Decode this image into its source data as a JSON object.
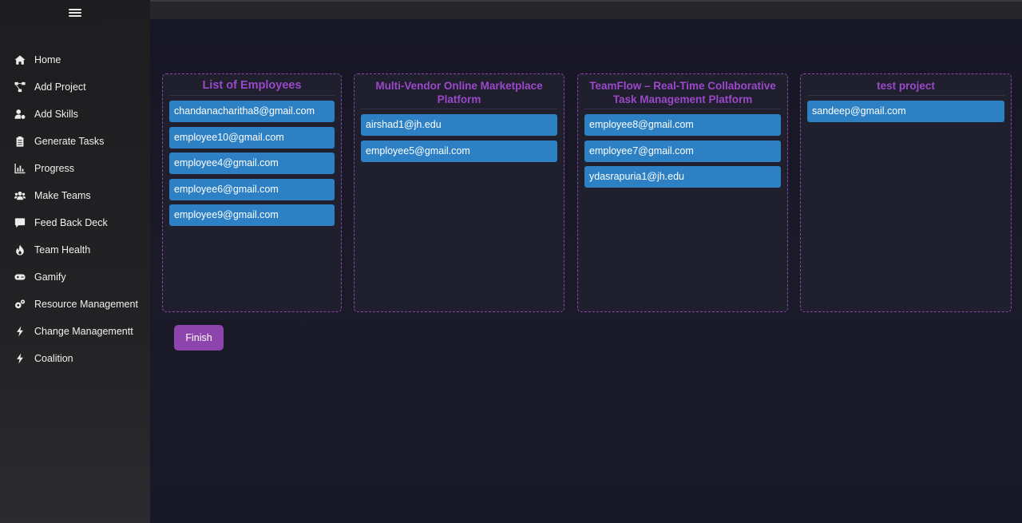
{
  "sidebar": {
    "menu_icon": "hamburger-icon",
    "items": [
      {
        "label": "Home",
        "icon": "home-icon"
      },
      {
        "label": "Add Project",
        "icon": "project-diagram-icon"
      },
      {
        "label": "Add Skills",
        "icon": "user-cog-icon"
      },
      {
        "label": "Generate Tasks",
        "icon": "clipboard-list-icon"
      },
      {
        "label": "Progress",
        "icon": "bar-chart-icon"
      },
      {
        "label": "Make Teams",
        "icon": "users-icon"
      },
      {
        "label": "Feed Back Deck",
        "icon": "comment-icon"
      },
      {
        "label": "Team Health",
        "icon": "fire-icon"
      },
      {
        "label": "Gamify",
        "icon": "gamepad-icon"
      },
      {
        "label": "Resource Management",
        "icon": "cogs-icon"
      },
      {
        "label": "Change Managementt",
        "icon": "bolt-icon"
      },
      {
        "label": "Coalition",
        "icon": "bolt-icon"
      }
    ]
  },
  "boards": [
    {
      "title": "List of Employees",
      "members": [
        "chandanacharitha8@gmail.com",
        "employee10@gmail.com",
        "employee4@gmail.com",
        "employee6@gmail.com",
        "employee9@gmail.com"
      ]
    },
    {
      "title": "Multi-Vendor Online Marketplace Platform",
      "members": [
        "airshad1@jh.edu",
        "employee5@gmail.com"
      ]
    },
    {
      "title": "TeamFlow – Real-Time Collaborative Task Management Platform",
      "members": [
        "employee8@gmail.com",
        "employee7@gmail.com",
        "ydasrapuria1@jh.edu"
      ]
    },
    {
      "title": "test project",
      "members": [
        "sandeep@gmail.com"
      ]
    }
  ],
  "actions": {
    "finish_label": "Finish"
  },
  "colors": {
    "accent": "#8e44ad",
    "chip": "#2c80c3",
    "title": "#9b48c9"
  }
}
